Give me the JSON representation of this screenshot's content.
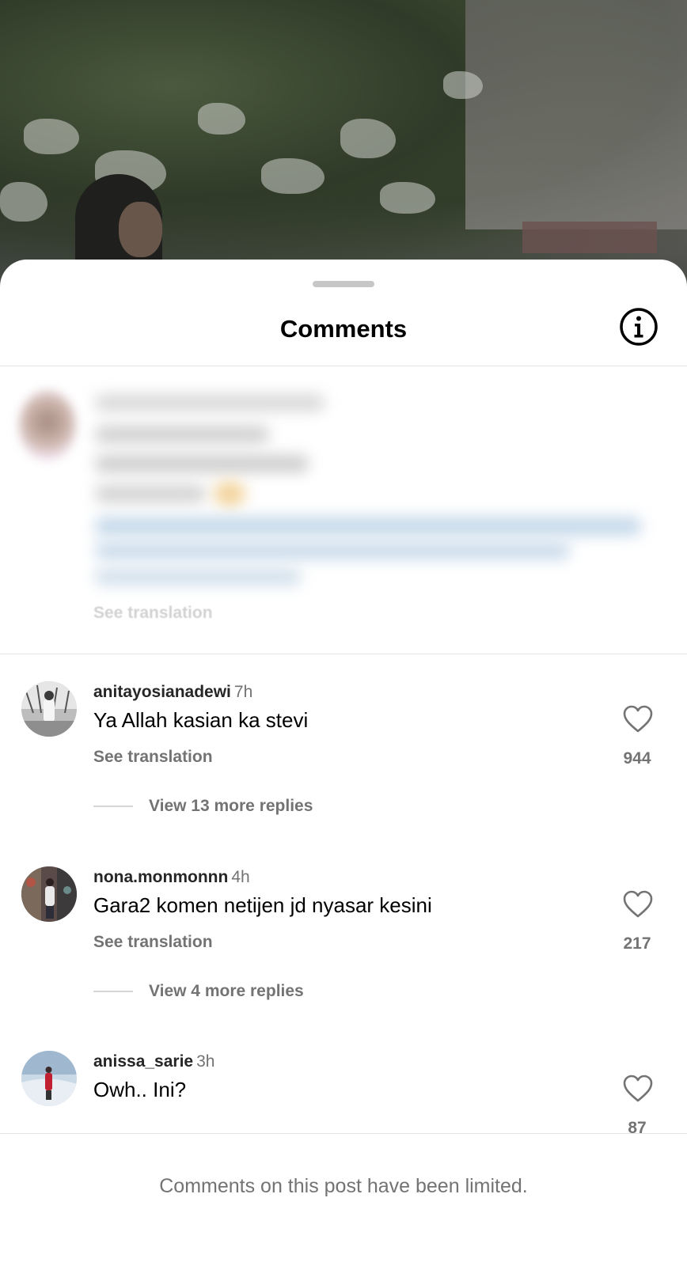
{
  "sheet": {
    "title": "Comments",
    "info_icon": "info-circle-icon"
  },
  "pinned": {
    "see_translation": "See translation"
  },
  "comments": [
    {
      "username": "anitayosianadewi",
      "time": "7h",
      "text": "Ya Allah kasian ka stevi",
      "see_translation": "See translation",
      "replies": "View 13 more replies",
      "likes": "944"
    },
    {
      "username": "nona.monmonnn",
      "time": "4h",
      "text": "Gara2 komen netijen jd nyasar kesini",
      "see_translation": "See translation",
      "replies": "View 4 more replies",
      "likes": "217"
    },
    {
      "username": "anissa_sarie",
      "time": "3h",
      "text": "Owh.. Ini?",
      "likes": "87"
    }
  ],
  "footer": {
    "notice": "Comments on this post have been limited."
  },
  "colors": {
    "secondary_text": "#737373",
    "primary_text": "#000000",
    "divider": "#e4e4e4"
  }
}
